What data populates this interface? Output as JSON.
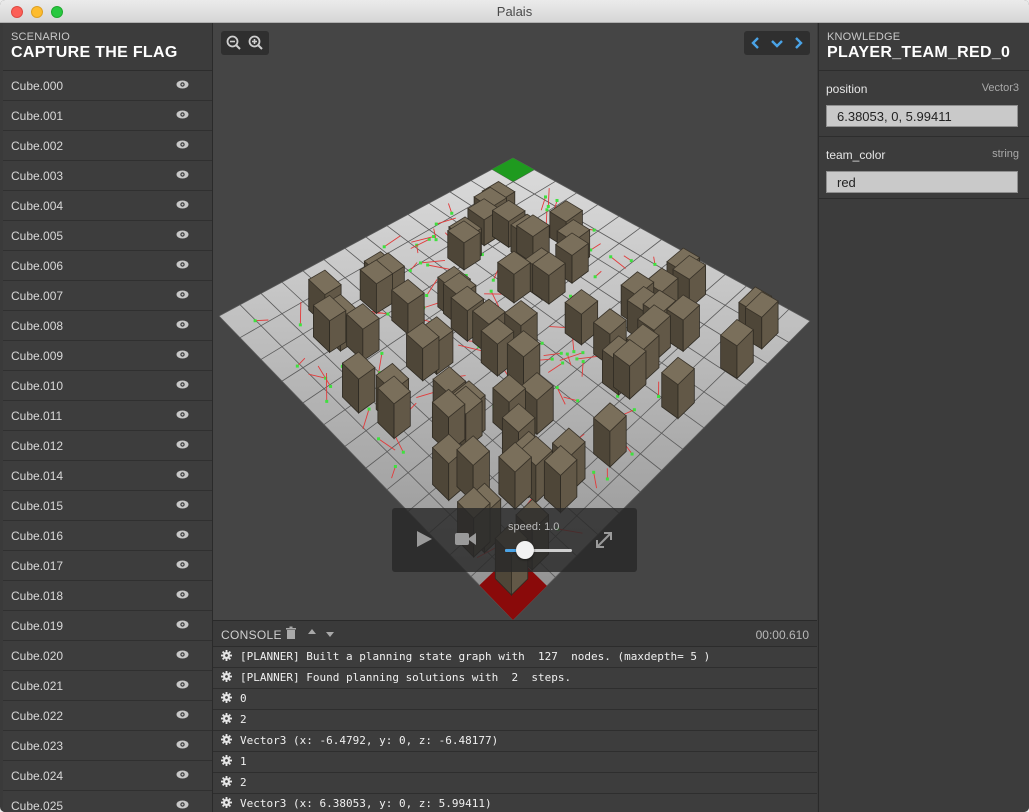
{
  "window": {
    "title": "Palais"
  },
  "scenario": {
    "kicker": "SCENARIO",
    "name": "CAPTURE THE FLAG",
    "items": [
      {
        "label": "Cube.000"
      },
      {
        "label": "Cube.001"
      },
      {
        "label": "Cube.002"
      },
      {
        "label": "Cube.003"
      },
      {
        "label": "Cube.004"
      },
      {
        "label": "Cube.005"
      },
      {
        "label": "Cube.006"
      },
      {
        "label": "Cube.007"
      },
      {
        "label": "Cube.008"
      },
      {
        "label": "Cube.009"
      },
      {
        "label": "Cube.010"
      },
      {
        "label": "Cube.011"
      },
      {
        "label": "Cube.012"
      },
      {
        "label": "Cube.014"
      },
      {
        "label": "Cube.015"
      },
      {
        "label": "Cube.016"
      },
      {
        "label": "Cube.017"
      },
      {
        "label": "Cube.018"
      },
      {
        "label": "Cube.019"
      },
      {
        "label": "Cube.020"
      },
      {
        "label": "Cube.021"
      },
      {
        "label": "Cube.022"
      },
      {
        "label": "Cube.023"
      },
      {
        "label": "Cube.024"
      },
      {
        "label": "Cube.025"
      }
    ]
  },
  "viewport": {
    "speed_label": "speed: 1.0",
    "speed_value": 1.0,
    "speed_fraction": 0.3,
    "icons": [
      "zoom-out-icon",
      "zoom-in-icon",
      "chevron-left-icon",
      "chevron-down-icon",
      "chevron-right-icon",
      "play-icon",
      "camera-icon",
      "expand-icon"
    ]
  },
  "console": {
    "title": "CONSOLE",
    "time": "00:00.610",
    "lines": [
      {
        "text": "[PLANNER] Built a planning state graph with  127  nodes. (maxdepth= 5 )"
      },
      {
        "text": "[PLANNER] Found planning solutions with  2  steps."
      },
      {
        "text": "0"
      },
      {
        "text": "2"
      },
      {
        "text": "Vector3 (x: -6.4792, y: 0, z: -6.48177)"
      },
      {
        "text": "1"
      },
      {
        "text": "2"
      },
      {
        "text": "Vector3 (x: 6.38053, y: 0, z: 5.99411)"
      }
    ]
  },
  "knowledge": {
    "kicker": "KNOWLEDGE",
    "name": "PLAYER_TEAM_RED_0",
    "props": [
      {
        "name": "position",
        "type": "Vector3",
        "value": "6.38053, 0, 5.99411"
      },
      {
        "name": "team_color",
        "type": "string",
        "value": "red"
      }
    ]
  },
  "colors": {
    "accent": "#4aa3e6",
    "flag_green": "#1f9a1f",
    "red_zone": "#8a0a0a"
  }
}
